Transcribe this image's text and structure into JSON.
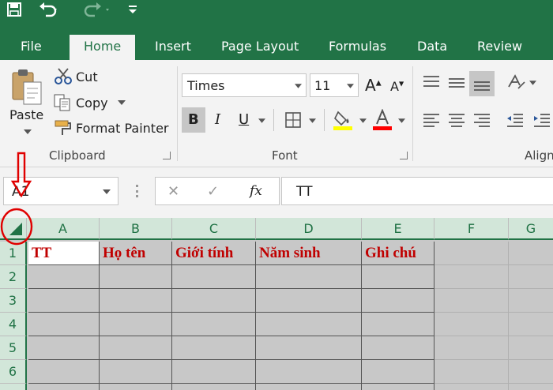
{
  "quick_access": {
    "save": "save-icon",
    "undo": "undo-icon",
    "redo": "redo-icon",
    "customize": "customize-icon"
  },
  "tabs": [
    {
      "label": "File"
    },
    {
      "label": "Home"
    },
    {
      "label": "Insert"
    },
    {
      "label": "Page Layout"
    },
    {
      "label": "Formulas"
    },
    {
      "label": "Data"
    },
    {
      "label": "Review"
    }
  ],
  "clipboard": {
    "paste": "Paste",
    "cut": "Cut",
    "copy": "Copy",
    "format_painter": "Format Painter",
    "group_label": "Clipboard"
  },
  "font": {
    "name": "Times",
    "size": "11",
    "bold": "B",
    "italic": "I",
    "underline": "U",
    "group_label": "Font",
    "fill_color": "#ffff00",
    "font_color": "#ff0000"
  },
  "alignment": {
    "group_label": "Align"
  },
  "formula_bar": {
    "name_box": "A1",
    "fx": "fx",
    "cancel": "✕",
    "enter": "✓",
    "content": "TT"
  },
  "columns": [
    "A",
    "B",
    "C",
    "D",
    "E",
    "F",
    "G"
  ],
  "rows": [
    "1",
    "2",
    "3",
    "4",
    "5",
    "6"
  ],
  "header_row": [
    "TT",
    "Họ tên",
    "Giới tính",
    "Năm sinh",
    "Ghi chú"
  ],
  "annotation": {
    "color": "#e00000"
  }
}
